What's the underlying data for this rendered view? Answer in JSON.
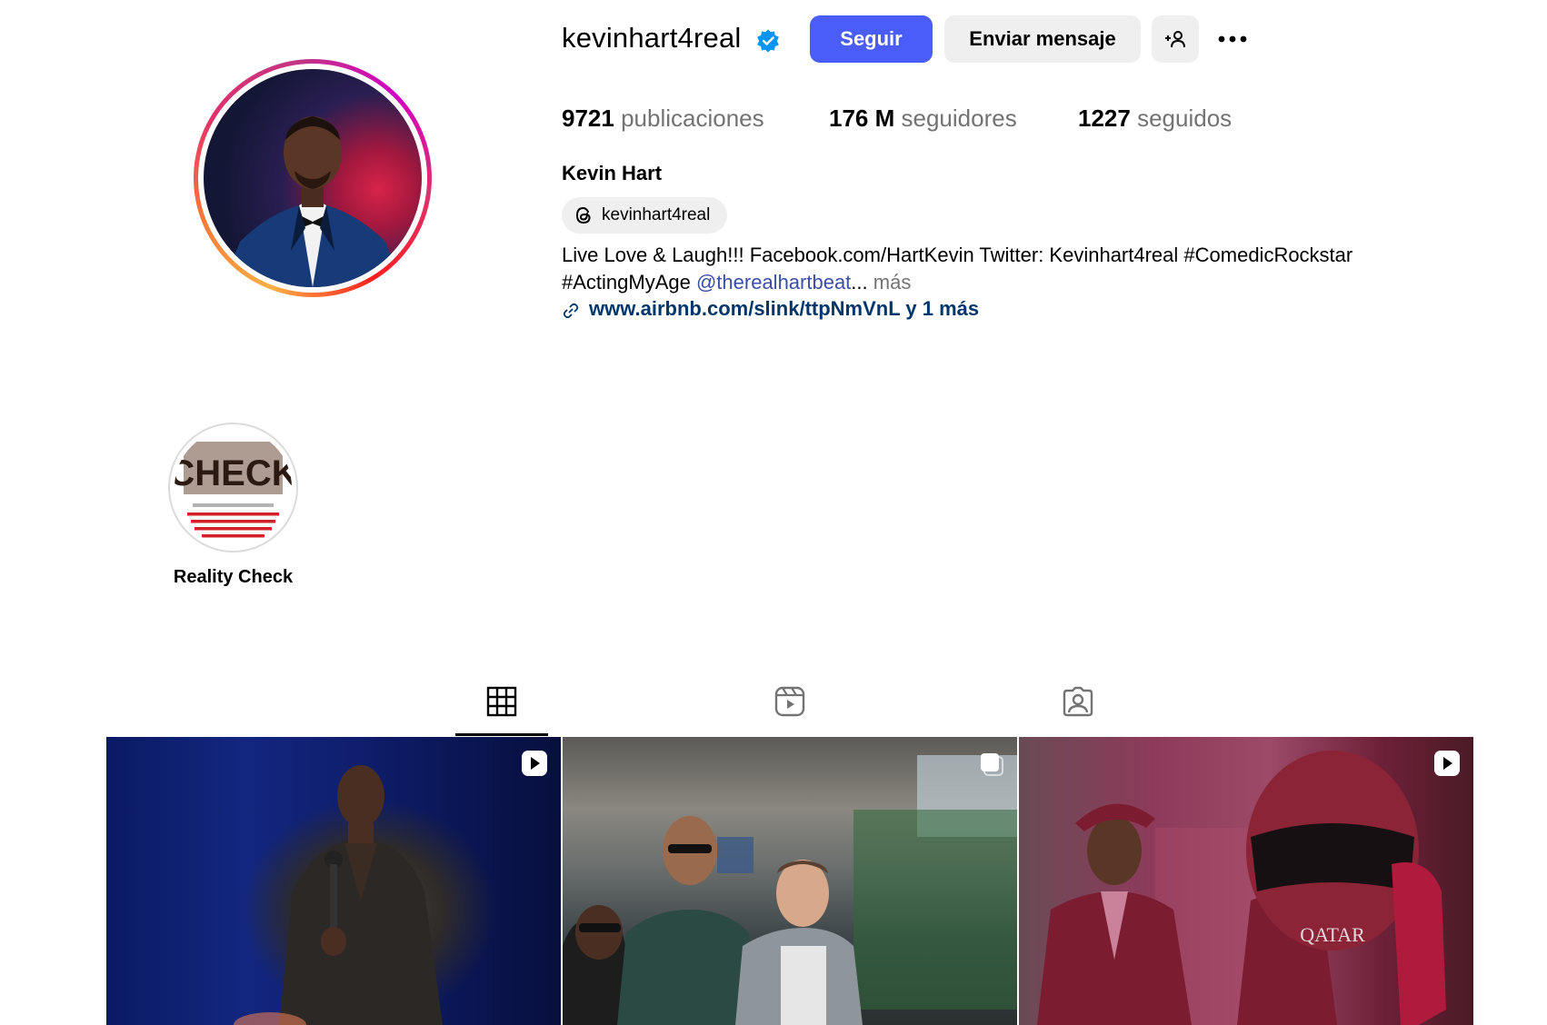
{
  "profile": {
    "username": "kevinhart4real",
    "verified": true,
    "follow_label": "Seguir",
    "message_label": "Enviar mensaje",
    "stats": {
      "posts_value": "9721",
      "posts_label": "publicaciones",
      "followers_value": "176 M",
      "followers_label": "seguidores",
      "following_value": "1227",
      "following_label": "seguidos"
    },
    "full_name": "Kevin Hart",
    "threads_handle": "kevinhart4real",
    "bio_line1": "Live Love & Laugh!!! Facebook.com/HartKevin Twitter: Kevinhart4real #ComedicRockstar",
    "bio_line2_prefix": "#ActingMyAge ",
    "bio_mention": "@therealhartbeat",
    "bio_ellipsis": "...",
    "bio_more": " más",
    "link_text": "www.airbnb.com/slink/ttpNmVnL y 1 más"
  },
  "highlights": [
    {
      "label": "Reality Check",
      "image_text": "CHECK"
    }
  ],
  "tabs": [
    {
      "name": "posts-grid",
      "icon": "grid-icon",
      "active": true
    },
    {
      "name": "reels",
      "icon": "reels-icon",
      "active": false
    },
    {
      "name": "tagged",
      "icon": "tagged-icon",
      "active": false
    }
  ],
  "posts": [
    {
      "type": "reel",
      "icon": "reel-badge-icon"
    },
    {
      "type": "carousel",
      "icon": "carousel-badge-icon"
    },
    {
      "type": "reel",
      "icon": "reel-badge-icon"
    }
  ],
  "colors": {
    "primary_button": "#4a5df9",
    "secondary_button": "#efefef",
    "verified_badge": "#0095f6",
    "link": "#00376b",
    "mention": "#3b4da8",
    "muted_text": "#737373"
  }
}
